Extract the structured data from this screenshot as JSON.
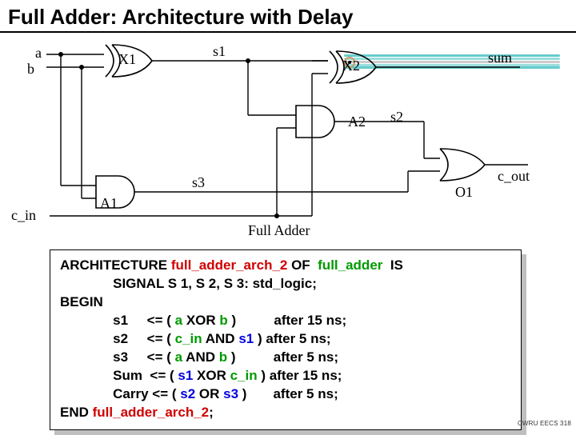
{
  "title": "Full Adder:  Architecture with Delay",
  "schematic": {
    "inputs": {
      "a": "a",
      "b": "b",
      "c_in": "c_in"
    },
    "outputs": {
      "sum": "sum",
      "c_out": "c_out"
    },
    "signals": {
      "s1": "s1",
      "s2": "s2",
      "s3": "s3"
    },
    "gates": {
      "X1": "X1",
      "X2": "X2",
      "A1": "A1",
      "A2": "A2",
      "O1": "O1"
    },
    "caption": "Full   Adder"
  },
  "code": {
    "l1a": "ARCHITECTURE ",
    "l1b": "full_adder_arch_2",
    "l1c": " OF ",
    "l1d": " full_adder ",
    "l1e": " IS",
    "l2": "              SIGNAL S 1, S 2, S 3: std_logic;",
    "l3": "BEGIN",
    "l4a": "              s1     <= ( ",
    "l4b": "a",
    "l4c": " XOR ",
    "l4d": "b",
    "l4e": " )          after 15 ns;",
    "l5a": "              s2     <= ( ",
    "l5b": "c_in",
    "l5c": " AND ",
    "l5d": "s1",
    "l5e": " ) after 5 ns;",
    "l6a": "              s3     <= ( ",
    "l6b": "a",
    "l6c": " AND ",
    "l6d": "b",
    "l6e": " )          after 5 ns;",
    "l7a": "              Sum  <= ( ",
    "l7b": "s1",
    "l7c": " XOR ",
    "l7d": "c_in",
    "l7e": " ) after 15 ns;",
    "l8a": "              Carry <= ( ",
    "l8b": "s2",
    "l8c": " OR ",
    "l8d": "s3",
    "l8e": " )       after 5 ns;",
    "l9a": "END ",
    "l9b": "full_adder_arch_2",
    "l9c": ";"
  },
  "footer": "CWRU EECS 318"
}
